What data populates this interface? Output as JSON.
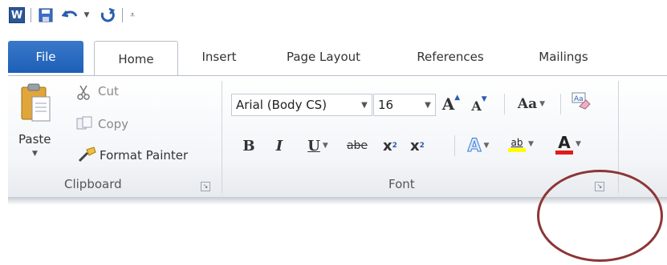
{
  "qat": {
    "word_icon": "W",
    "items": [
      "word-app-icon",
      "save-icon",
      "undo-icon",
      "redo-icon",
      "customize-icon"
    ]
  },
  "tabs": {
    "file": "File",
    "home": "Home",
    "insert": "Insert",
    "page_layout": "Page Layout",
    "references": "References",
    "mailings": "Mailings"
  },
  "clipboard": {
    "paste": "Paste",
    "cut": "Cut",
    "copy": "Copy",
    "format_painter": "Format Painter",
    "group_label": "Clipboard"
  },
  "font": {
    "font_name": "Arial (Body CS)",
    "font_size": "16",
    "grow_font": "A",
    "shrink_font": "A",
    "change_case": "Aa",
    "bold": "B",
    "italic": "I",
    "underline": "U",
    "strikethrough": "abe",
    "subscript": "x",
    "subscript_mark": "2",
    "superscript": "x",
    "superscript_mark": "2",
    "text_effects": "A",
    "highlight": "ab",
    "font_color": "A",
    "group_label": "Font"
  },
  "colors": {
    "file_tab": "#2b6cc4",
    "highlight_yellow": "#ffff00",
    "font_color_red": "#e11b1b",
    "annotation": "#8c3535"
  }
}
